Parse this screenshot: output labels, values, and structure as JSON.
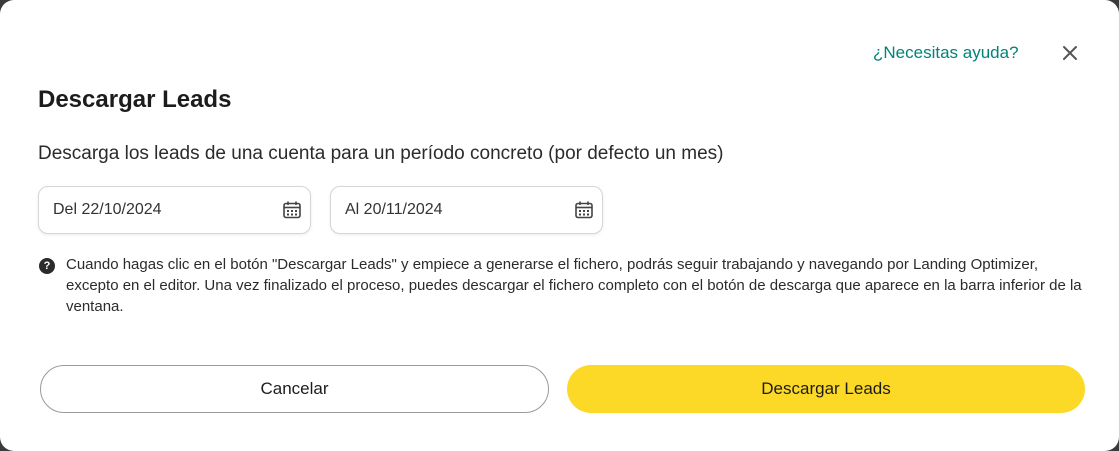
{
  "dialog": {
    "help_link": "¿Necesitas ayuda?",
    "close_icon": "close-icon",
    "title": "Descargar Leads",
    "subtitle": "Descarga los leads de una cuenta para un período concreto (por defecto un mes)",
    "date_from": {
      "value": "Del 22/10/2024",
      "icon": "calendar-icon"
    },
    "date_to": {
      "value": "Al 20/11/2024",
      "icon": "calendar-icon"
    },
    "info": {
      "icon": "question-circle-icon",
      "text": "Cuando hagas clic en el botón \"Descargar Leads\" y empiece a generarse el fichero, podrás seguir trabajando y navegando por Landing Optimizer, excepto en el editor. Una vez finalizado el proceso, puedes descargar el fichero completo con el botón de descarga que aparece en la barra inferior de la ventana."
    },
    "buttons": {
      "cancel": "Cancelar",
      "download": "Descargar Leads"
    },
    "colors": {
      "link": "#00847a",
      "primary_button": "#fdd927"
    }
  }
}
